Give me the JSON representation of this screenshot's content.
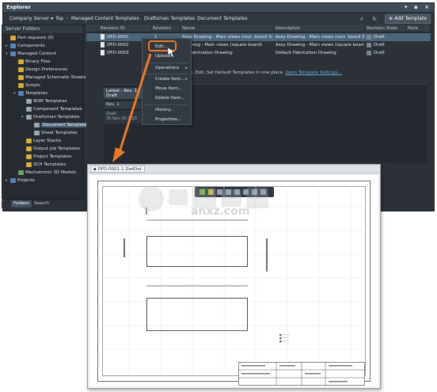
{
  "window": {
    "title": "Explorer",
    "controls": "▾ ▪ ×"
  },
  "toolbar": {
    "server": "Company Server",
    "crumbs": [
      "Top",
      "Managed Content",
      "Templates",
      "Draftsman Templates",
      "Document Templates"
    ],
    "add_template": "Add Template"
  },
  "sidebar": {
    "header": "Server Folders",
    "items": [
      {
        "label": "Part requests (0)",
        "indent": 0
      },
      {
        "label": "Components",
        "indent": 0
      },
      {
        "label": "Managed Content",
        "indent": 0
      },
      {
        "label": "Binary Files",
        "indent": 1
      },
      {
        "label": "Design Preferences",
        "indent": 1
      },
      {
        "label": "Managed Schematic Sheets",
        "indent": 1
      },
      {
        "label": "Scripts",
        "indent": 1
      },
      {
        "label": "Templates",
        "indent": 1
      },
      {
        "label": "BOM Templates",
        "indent": 2
      },
      {
        "label": "Component Templates",
        "indent": 2
      },
      {
        "label": "Draftsman Templates",
        "indent": 2
      },
      {
        "label": "Document Templates",
        "indent": 3
      },
      {
        "label": "Sheet Templates",
        "indent": 3
      },
      {
        "label": "Layer Stacks",
        "indent": 2
      },
      {
        "label": "Output Job Templates",
        "indent": 2
      },
      {
        "label": "Project Templates",
        "indent": 2
      },
      {
        "label": "SCH Templates",
        "indent": 2
      },
      {
        "label": "Mechatronic 3D Models",
        "indent": 1
      },
      {
        "label": "Projects",
        "indent": 0
      }
    ],
    "tabs": [
      "Folders",
      "Search"
    ]
  },
  "table": {
    "headers": [
      "Revision ID",
      "Revision",
      "Name",
      "Description",
      "Revision State",
      "Note"
    ],
    "rows": [
      {
        "id": "DFD-0001",
        "rev": "1",
        "name": "Assy Drawing - Main views (rect. board 3x1)",
        "desc": "Assy Drawing - Main views (rect. board 3x1)",
        "state": "Draft"
      },
      {
        "id": "DFD-0002",
        "rev": "",
        "name": "Drawing - Main views (square board)",
        "desc": "Assy Drawing - Main views (square board)",
        "state": "Draft"
      },
      {
        "id": "DFD-0003",
        "rev": "",
        "name": "ult Fabrication Drawing",
        "desc": "Default Fabrication Drawing",
        "state": "Draft"
      }
    ]
  },
  "info": {
    "text": "reate, Edit, Set Default Templates in one place.",
    "link": "Open Template Settings..."
  },
  "rev_panel": {
    "head": "Latest - Rev. 1",
    "head_sub": "Draft",
    "rev_label": "Rev. 1",
    "draft": "Draft",
    "date": "25-Nov-20 1:20"
  },
  "context_menu": {
    "items": [
      "Edit...",
      "Upload...",
      "Operations",
      "Create Item...",
      "Move Item...",
      "Delete Item...",
      "History...",
      "Properties..."
    ]
  },
  "doc": {
    "tab": "DFD-0001-1.DwfDot"
  },
  "brand_text": "anxz.com"
}
